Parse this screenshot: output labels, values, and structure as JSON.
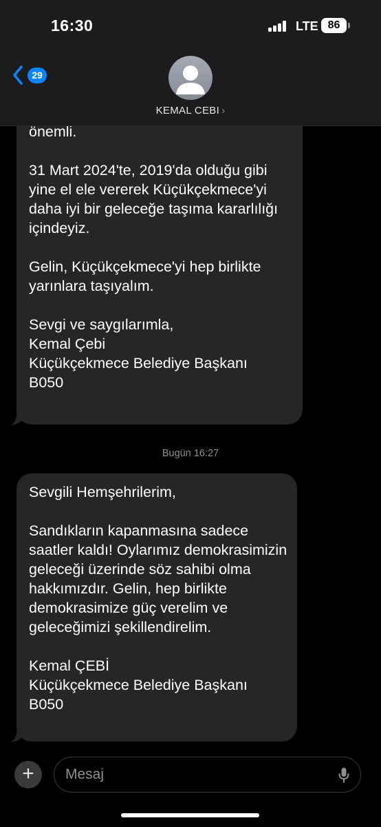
{
  "status_bar": {
    "time": "16:30",
    "network": "LTE",
    "battery": "86"
  },
  "header": {
    "back_count": "29",
    "contact_name": "KEMAL CEBI",
    "chevron": "›",
    "avatar_icon": "person-silhouette-icon"
  },
  "messages": [
    {
      "paragraphs": [
        "önemli.",
        "31 Mart 2024'te, 2019'da olduğu gibi yine el ele vererek Küçükçekmece'yi daha iyi bir geleceğe taşıma kararlılığı içindeyiz.",
        "Gelin, Küçükçekmece'yi hep birlikte yarınlara taşıyalım.",
        "Sevgi ve saygılarımla,\nKemal Çebi\nKüçükçekmece Belediye Başkanı\nB050"
      ]
    },
    {
      "timestamp": "Bugün 16:27",
      "paragraphs": [
        "Sevgili Hemşehrilerim,",
        "Sandıkların kapanmasına sadece saatler kaldı! Oylarımız demokrasimizin geleceği üzerinde söz sahibi olma hakkımızdır. Gelin, hep birlikte demokrasimize güç verelim ve geleceğimizi şekillendirelim.",
        "Kemal ÇEBİ\nKüçükçekmece Belediye Başkanı\nB050"
      ]
    }
  ],
  "input": {
    "placeholder": "Mesaj",
    "plus": "+"
  },
  "colors": {
    "background": "#000000",
    "header": "#1c1c1e",
    "bubble": "#262628",
    "accent": "#0a84ff",
    "secondary_text": "#8e8e93"
  }
}
